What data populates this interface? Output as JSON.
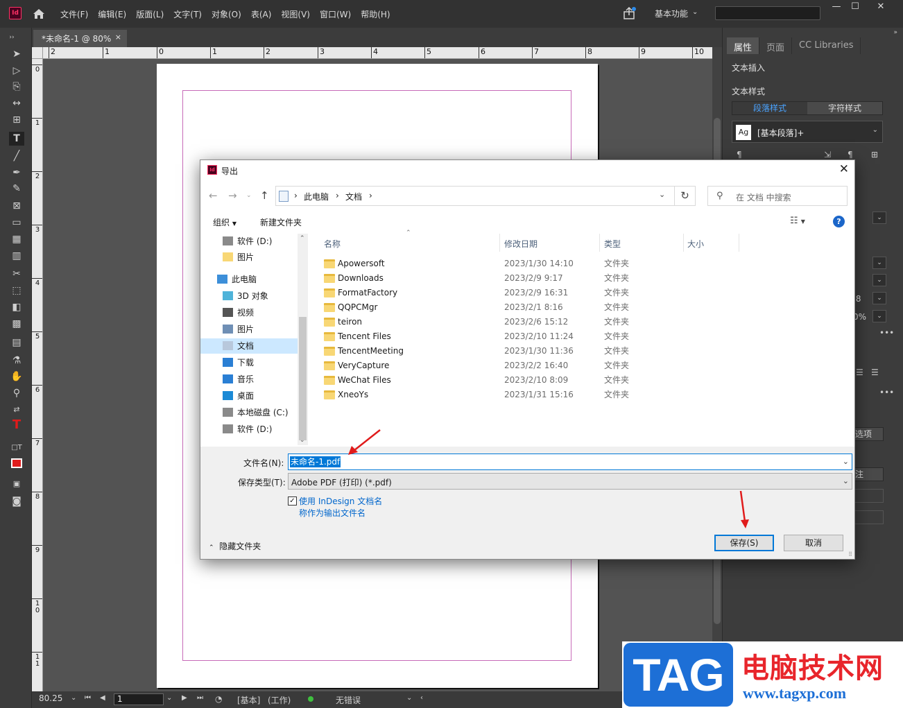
{
  "app": {
    "logo": "Id",
    "menus": [
      "文件(F)",
      "编辑(E)",
      "版面(L)",
      "文字(T)",
      "对象(O)",
      "表(A)",
      "视图(V)",
      "窗口(W)",
      "帮助(H)"
    ],
    "workspace": "基本功能",
    "window_controls": [
      "—",
      "☐",
      "✕"
    ]
  },
  "document_tab": {
    "title": "*未命名-1 @ 80%",
    "close": "×"
  },
  "rulers": {
    "horizontal": [
      "2",
      "1",
      "0",
      "1",
      "2",
      "3",
      "4",
      "5",
      "6",
      "7",
      "8",
      "9",
      "10"
    ],
    "vertical": [
      "0",
      "1",
      "2",
      "3",
      "4",
      "5",
      "6",
      "7",
      "8",
      "9",
      "1\n0",
      "1\n1"
    ]
  },
  "status_bar": {
    "zoom": "80.25",
    "page": "1",
    "style_text": "[基本]",
    "work_text": "(工作)",
    "errors": "无错误"
  },
  "right_panel": {
    "tabs": [
      "属性",
      "页面",
      "CC Libraries"
    ],
    "active_tab": "属性",
    "section_text_insert": "文本插入",
    "section_text_style": "文本样式",
    "style_tabs": [
      "段落样式",
      "字符样式"
    ],
    "para_style_value": "[基本段落]+",
    "ag": "Ag",
    "partial": [
      ".8",
      "0%",
      "选项",
      "注"
    ]
  },
  "dialog": {
    "icon": "Id",
    "title": "导出",
    "close": "✕",
    "breadcrumb": [
      "此电脑",
      "文档"
    ],
    "search_placeholder": "在 文档 中搜索",
    "toolbar": {
      "organize": "组织",
      "new_folder": "新建文件夹",
      "help": "?"
    },
    "nav_items": [
      {
        "label": "软件 (D:)",
        "icon": "drive-icon"
      },
      {
        "label": "图片",
        "icon": "folder-icon"
      },
      {
        "label": "此电脑",
        "icon": "computer-icon"
      },
      {
        "label": "3D 对象",
        "icon": "3d-objects-icon"
      },
      {
        "label": "视频",
        "icon": "video-icon"
      },
      {
        "label": "图片",
        "icon": "pictures-icon"
      },
      {
        "label": "文档",
        "icon": "documents-icon",
        "selected": true
      },
      {
        "label": "下载",
        "icon": "download-icon"
      },
      {
        "label": "音乐",
        "icon": "music-icon"
      },
      {
        "label": "桌面",
        "icon": "desktop-icon"
      },
      {
        "label": "本地磁盘 (C:)",
        "icon": "drive-icon"
      },
      {
        "label": "软件 (D:)",
        "icon": "drive-icon"
      }
    ],
    "columns": [
      "名称",
      "修改日期",
      "类型",
      "大小"
    ],
    "files": [
      {
        "name": "Apowersoft",
        "date": "2023/1/30 14:10",
        "type": "文件夹"
      },
      {
        "name": "Downloads",
        "date": "2023/2/9 9:17",
        "type": "文件夹"
      },
      {
        "name": "FormatFactory",
        "date": "2023/2/9 16:31",
        "type": "文件夹"
      },
      {
        "name": "QQPCMgr",
        "date": "2023/2/1 8:16",
        "type": "文件夹"
      },
      {
        "name": "teiron",
        "date": "2023/2/6 15:12",
        "type": "文件夹"
      },
      {
        "name": "Tencent Files",
        "date": "2023/2/10 11:24",
        "type": "文件夹"
      },
      {
        "name": "TencentMeeting",
        "date": "2023/1/30 11:36",
        "type": "文件夹"
      },
      {
        "name": "VeryCapture",
        "date": "2023/2/2 16:40",
        "type": "文件夹"
      },
      {
        "name": "WeChat Files",
        "date": "2023/2/10 8:09",
        "type": "文件夹"
      },
      {
        "name": "XneoYs",
        "date": "2023/1/31 15:16",
        "type": "文件夹"
      }
    ],
    "filename_label": "文件名(N):",
    "filename_value": "未命名-1.pdf",
    "filetype_label": "保存类型(T):",
    "filetype_value": "Adobe PDF (打印)   (*.pdf)",
    "use_name_checked": true,
    "use_name_line1": "使用 InDesign 文档名",
    "use_name_line2": "称作为输出文件名",
    "hide_folders": "隐藏文件夹",
    "save": "保存(S)",
    "cancel": "取消"
  },
  "watermark": {
    "tag": "TAG",
    "cn": "电脑技术网",
    "url": "www.tagxp.com"
  },
  "colors": {
    "accent": "#0078d7",
    "annotation_arrow": "#e01b1b",
    "indesign": "#ff3366"
  }
}
